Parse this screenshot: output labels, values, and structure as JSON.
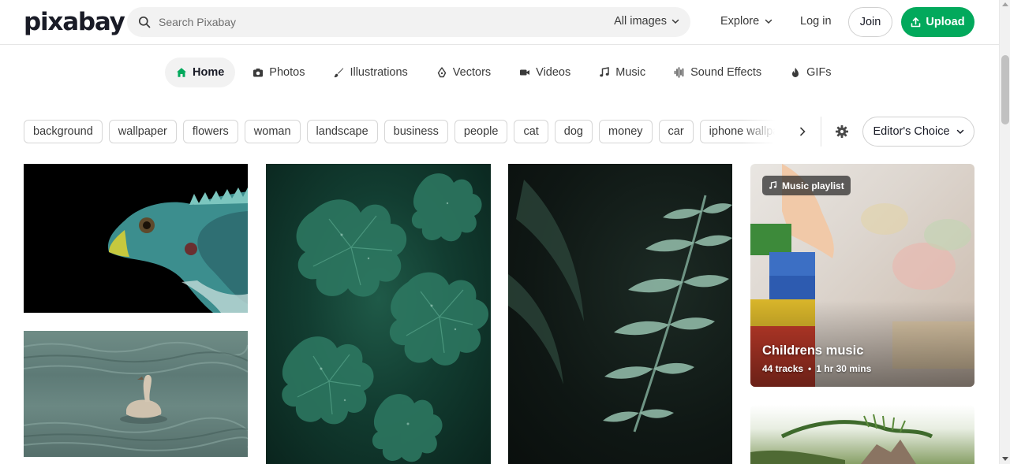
{
  "header": {
    "logo": "pixabay",
    "search_placeholder": "Search Pixabay",
    "search_scope": "All images",
    "explore": "Explore",
    "login": "Log in",
    "join": "Join",
    "upload": "Upload",
    "accent_color": "#02a95c"
  },
  "tabs": [
    {
      "label": "Home",
      "icon": "home-icon",
      "active": true
    },
    {
      "label": "Photos",
      "icon": "camera-icon"
    },
    {
      "label": "Illustrations",
      "icon": "brush-icon"
    },
    {
      "label": "Vectors",
      "icon": "pen-nib-icon"
    },
    {
      "label": "Videos",
      "icon": "video-camera-icon"
    },
    {
      "label": "Music",
      "icon": "music-note-icon"
    },
    {
      "label": "Sound Effects",
      "icon": "waveform-icon"
    },
    {
      "label": "GIFs",
      "icon": "flame-icon"
    }
  ],
  "tags": [
    "background",
    "wallpaper",
    "flowers",
    "woman",
    "landscape",
    "business",
    "people",
    "cat",
    "dog",
    "money",
    "car",
    "iphone wallpaper"
  ],
  "filter": {
    "sort": "Editor's Choice"
  },
  "music_card": {
    "badge": "Music playlist",
    "title": "Childrens music",
    "tracks": "44 tracks",
    "separator": "•",
    "duration": "1 hr 30 mins"
  }
}
